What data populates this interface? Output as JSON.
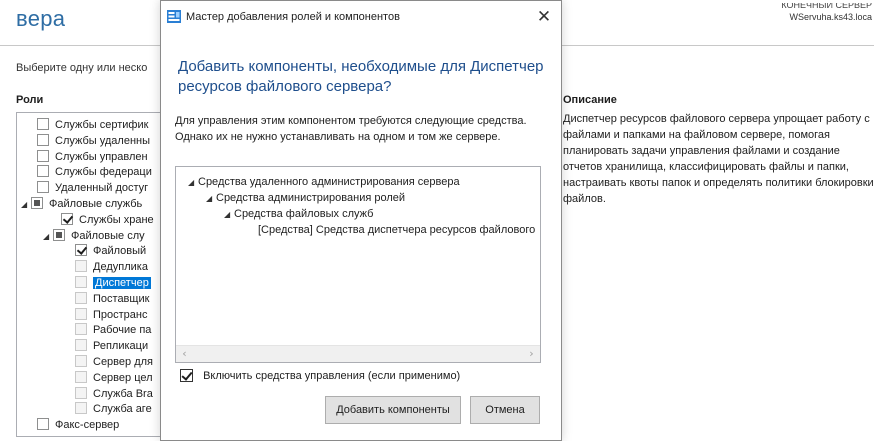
{
  "background": {
    "title": "вера",
    "destination_line1": "КОНЕЧНЫЙ СЕРВЕР",
    "destination_line2": "WServuha.ks43.loca",
    "instruction": "Выберите одну или неско",
    "roles_header": "Роли",
    "roles": [
      {
        "label": "Службы сертифик",
        "state": "unchecked",
        "expander": ""
      },
      {
        "label": "Службы удаленны",
        "state": "unchecked",
        "expander": ""
      },
      {
        "label": "Службы управлен",
        "state": "unchecked",
        "expander": ""
      },
      {
        "label": "Службы федераци",
        "state": "unchecked",
        "expander": ""
      },
      {
        "label": "Удаленный достуг",
        "state": "unchecked",
        "expander": ""
      },
      {
        "label": "Файловые службь",
        "state": "partial",
        "expander": "◢"
      },
      {
        "label": "Службы хране",
        "state": "checked",
        "expander": ""
      },
      {
        "label": "Файловые слу",
        "state": "partial",
        "expander": "◢"
      },
      {
        "label": "Файловый",
        "state": "checked",
        "expander": ""
      },
      {
        "label": "Дедуплика",
        "state": "unchecked",
        "expander": ""
      },
      {
        "label": "Диспетчер",
        "state": "unchecked",
        "expander": "",
        "selected": true
      },
      {
        "label": "Поставщик",
        "state": "unchecked",
        "expander": ""
      },
      {
        "label": "Пространс",
        "state": "unchecked",
        "expander": ""
      },
      {
        "label": "Рабочие па",
        "state": "unchecked",
        "expander": ""
      },
      {
        "label": "Репликаци",
        "state": "unchecked",
        "expander": ""
      },
      {
        "label": "Сервер для",
        "state": "unchecked",
        "expander": ""
      },
      {
        "label": "Сервер цел",
        "state": "unchecked",
        "expander": ""
      },
      {
        "label": "Служба Bra",
        "state": "unchecked",
        "expander": ""
      },
      {
        "label": "Служба аге",
        "state": "unchecked",
        "expander": ""
      },
      {
        "label": "Факс-сервер",
        "state": "unchecked",
        "expander": ""
      }
    ],
    "description_header": "Описание",
    "description_text": "Диспетчер ресурсов файлового сервера упрощает работу с файлами и папками на файловом сервере, помогая планировать задачи управления файлами и создание отчетов хранилища, классифицировать файлы и папки, настраивать квоты папок и определять политики блокировки файлов."
  },
  "dialog": {
    "title": "Мастер добавления ролей и компонентов",
    "close_glyph": "✕",
    "heading": "Добавить компоненты, необходимые для Диспетчер ресурсов файлового сервера?",
    "info": "Для управления этим компонентом требуются следующие средства. Однако их не нужно устанавливать на одном и том же сервере.",
    "tree": [
      {
        "label": "Средства удаленного администрирования сервера",
        "level": 0,
        "expander": "◢"
      },
      {
        "label": "Средства администрирования ролей",
        "level": 1,
        "expander": "◢"
      },
      {
        "label": "Средства файловых служб",
        "level": 2,
        "expander": "◢"
      },
      {
        "label": "[Средства] Средства диспетчера ресурсов файлового",
        "level": 3,
        "expander": ""
      }
    ],
    "scroll_left": "‹",
    "scroll_right": "›",
    "include_tools_label": "Включить средства управления (если применимо)",
    "include_tools_checked": true,
    "add_button": "Добавить компоненты",
    "cancel_button": "Отмена",
    "colors": {
      "accent": "#0078d7",
      "heading": "#1e4e8c",
      "title_blue": "#2e6da4"
    }
  }
}
